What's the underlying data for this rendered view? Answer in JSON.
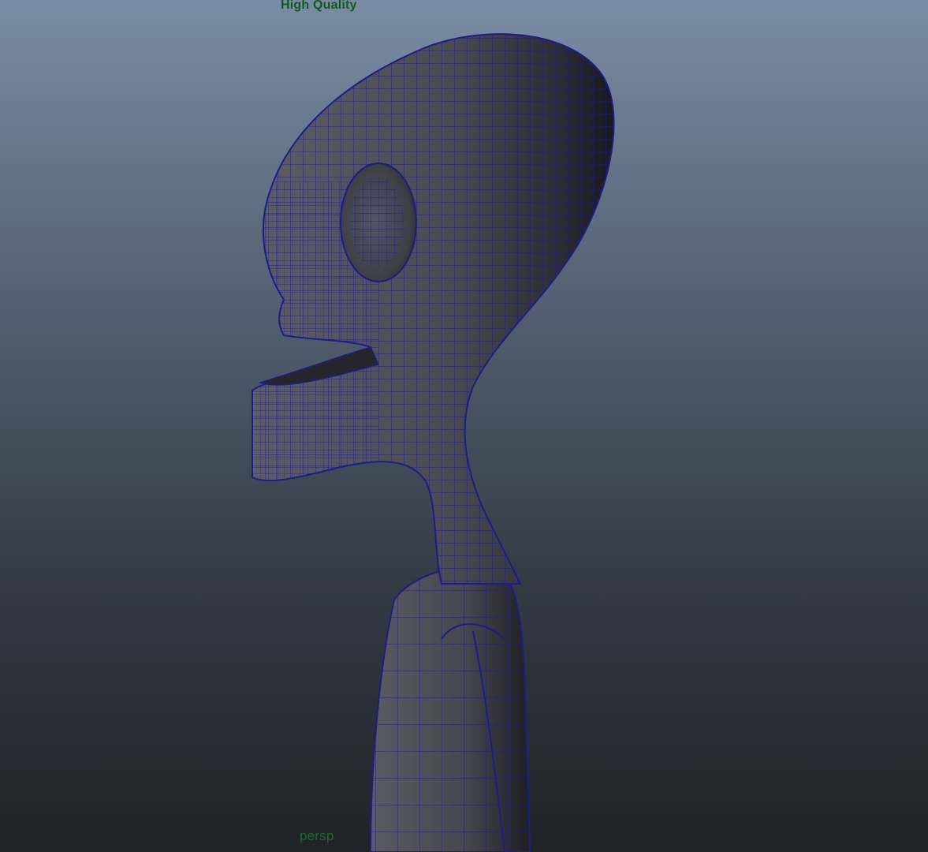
{
  "viewport": {
    "quality_label": "High Quality",
    "camera_label": "persp"
  },
  "colors": {
    "hud_quality_text": "#0f5a1c",
    "hud_camera_text": "#1b6a28",
    "wireframe": "#1d1d86",
    "mesh_surface": "#4a4a52",
    "background_top": "#7a8ca5",
    "background_bottom": "#1f2328"
  },
  "icons": {
    "model": "alien-character-mesh-icon"
  }
}
